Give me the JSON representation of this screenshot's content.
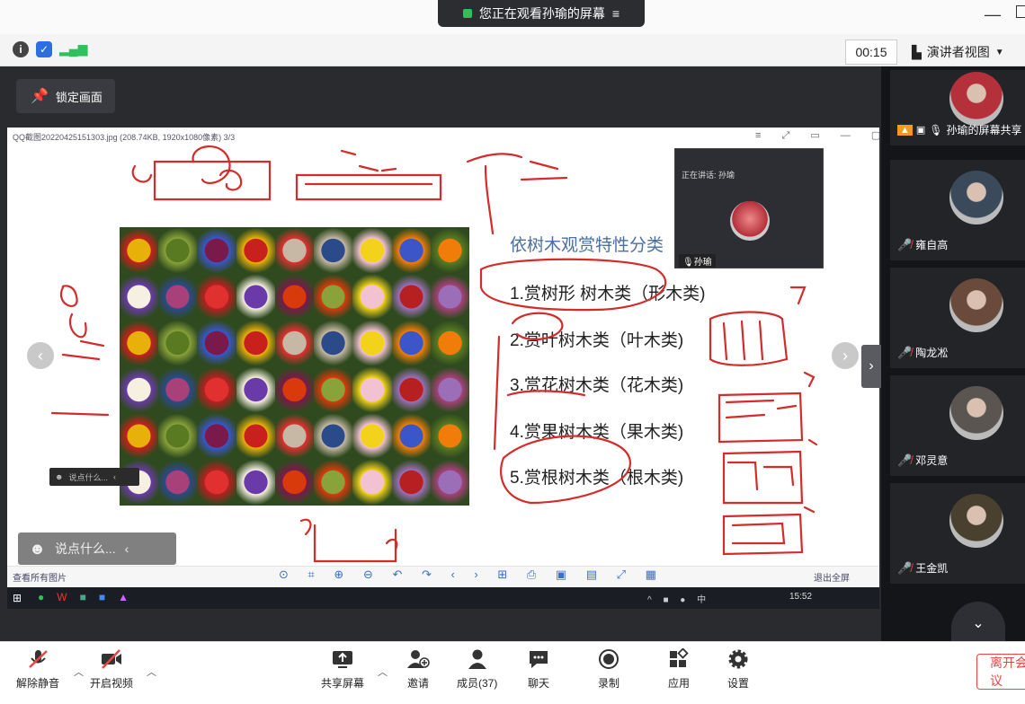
{
  "top": {
    "sharing_text": "您正在观看孙瑜的屏幕"
  },
  "infobar": {
    "timer": "00:15",
    "speaker_view": "演讲者视图"
  },
  "main": {
    "lock_label": "锁定画面"
  },
  "viewer": {
    "title": "QQ截图20220425151303.jpg (208.74KB, 1920x1080像素) 3/3",
    "show_all": "查看所有图片",
    "exit_fullscreen": "退出全屏"
  },
  "chart_data": {
    "type": "table",
    "title": "依树木观赏特性分类",
    "rows": [
      "1.赏树形 树木类（形木类)",
      "2.赏叶树木类（叶木类)",
      "3.赏花树木类（花木类)",
      "4.赏果树木类（果木类)",
      "5.赏根树木类（根木类)"
    ]
  },
  "mini_tile": {
    "talking": "正在讲话: 孙瑜",
    "name": "孙瑜"
  },
  "chat": {
    "small_placeholder": "说点什么...",
    "big_placeholder": "说点什么..."
  },
  "taskbar": {
    "time": "15:52",
    "sys": "中"
  },
  "participants": [
    {
      "name": "孙瑜的屏幕共享",
      "color": "#b4303a"
    },
    {
      "name": "雍自高",
      "color": "#3a4a5a"
    },
    {
      "name": "陶龙凇",
      "color": "#6a4a3a"
    },
    {
      "name": "邓灵意",
      "color": "#5a5550"
    },
    {
      "name": "王金凯",
      "color": "#4a4030"
    }
  ],
  "toolbar": {
    "unmute": "解除静音",
    "start_video": "开启视频",
    "share_screen": "共享屏幕",
    "invite": "邀请",
    "members": "成员(37)",
    "chat": "聊天",
    "record": "录制",
    "apps": "应用",
    "settings": "设置",
    "leave": "离开会议"
  },
  "colors": {
    "accent": "#2ec15b",
    "mute_red": "#e44",
    "title_blue": "#4a6fa5",
    "ink_red": "#d42b2b"
  }
}
